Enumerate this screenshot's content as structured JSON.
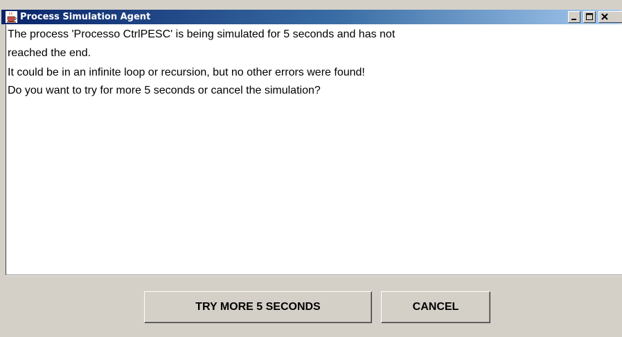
{
  "window": {
    "title": "Process Simulation Agent",
    "title_bar_gradient_start": "#0a246a",
    "title_bar_gradient_end": "#a6caf0",
    "app_icon": "java-cup-icon",
    "controls": {
      "minimize_icon": "minimize-icon",
      "maximize_icon": "maximize-icon",
      "close_icon": "close-icon"
    }
  },
  "message": {
    "lines": [
      "The process 'Processo CtrlPESC' is being simulated for 5 seconds and has not",
      "reached the end.",
      "It could be in an infinite loop or recursion, but no other errors were found!",
      "Do you want to try for more 5 seconds or cancel the simulation?"
    ]
  },
  "buttons": {
    "try_more_label": "TRY MORE 5 SECONDS",
    "cancel_label": "CANCEL"
  }
}
